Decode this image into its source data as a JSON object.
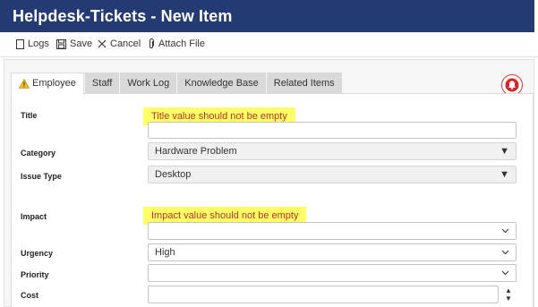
{
  "window": {
    "title": "Helpdesk-Tickets - New Item"
  },
  "toolbar": {
    "logs_label": "Logs",
    "save_label": "Save",
    "cancel_label": "Cancel",
    "attach_label": "Attach File"
  },
  "tabs": [
    {
      "label": "Employee",
      "active": true,
      "icon": "warning-icon"
    },
    {
      "label": "Staff"
    },
    {
      "label": "Work Log"
    },
    {
      "label": "Knowledge Base"
    },
    {
      "label": "Related Items"
    }
  ],
  "alert_icon": "bell-icon",
  "accent_color": "#243a73",
  "error_highlight_color": "#ffff66",
  "form": {
    "title": {
      "label": "Title",
      "error": "Title value should not be empty",
      "value": ""
    },
    "category": {
      "label": "Category",
      "value": "Hardware Problem"
    },
    "issue_type": {
      "label": "Issue Type",
      "value": "Desktop"
    },
    "impact": {
      "label": "Impact",
      "error": "Impact value should not be empty",
      "value": ""
    },
    "urgency": {
      "label": "Urgency",
      "value": "High"
    },
    "priority": {
      "label": "Priority",
      "value": ""
    },
    "cost": {
      "label": "Cost",
      "value": ""
    }
  }
}
